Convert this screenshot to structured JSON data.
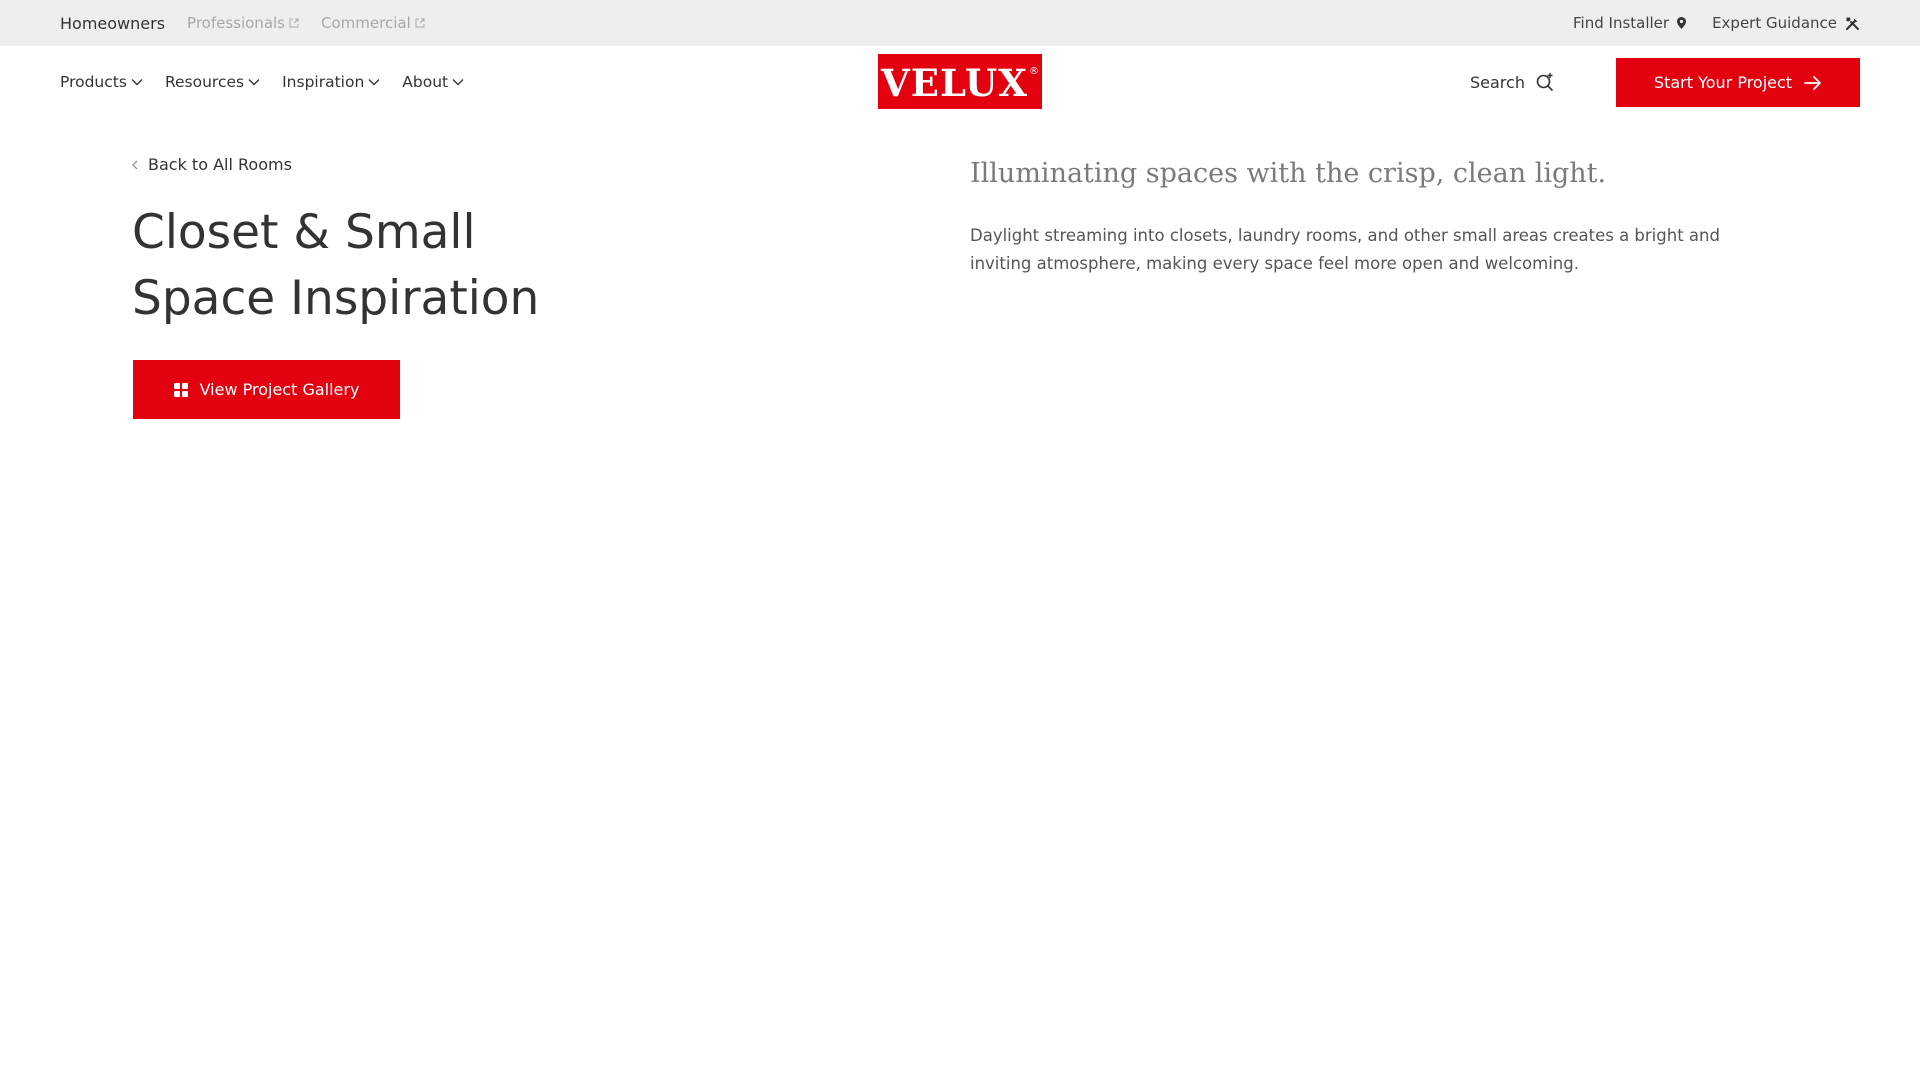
{
  "utility_bar": {
    "audience_active": "Homeowners",
    "audience_links": [
      "Professionals",
      "Commercial"
    ],
    "find_installer": "Find Installer",
    "expert_guidance": "Expert Guidance"
  },
  "nav": {
    "items": [
      "Products",
      "Resources",
      "Inspiration",
      "About"
    ]
  },
  "logo": {
    "text": "VELUX",
    "reg": "®"
  },
  "header": {
    "search_label": "Search",
    "cta_label": "Start Your Project"
  },
  "content": {
    "back_link": "Back to All Rooms",
    "title_line1": "Closet & Small",
    "title_line2": "Space Inspiration",
    "gallery_button": "View Project Gallery",
    "intro_heading": "Illuminating spaces with the crisp, clean light.",
    "intro_body": "Daylight streaming into closets, laundry rooms, and other small areas creates a bright and inviting atmosphere, making every space feel more open and welcoming."
  },
  "colors": {
    "brand_red": "#e3000f",
    "utility_bg": "#efeeec",
    "text_dark": "#333333",
    "text_muted": "#a8a8a8"
  },
  "icons": {
    "external": "external-link-icon",
    "location": "location-pin-icon",
    "tools": "tools-icon",
    "chevron": "chevron-down-icon",
    "search": "search-icon",
    "arrow": "arrow-right-icon",
    "grid": "grid-icon",
    "back": "chevron-left-icon"
  }
}
